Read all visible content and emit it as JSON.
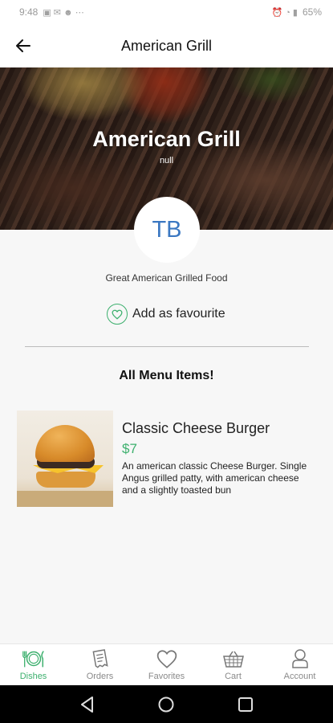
{
  "status_bar": {
    "time": "9:48",
    "left_glyphs": "▣ ✉ ☻ ⋯",
    "right_glyphs": "⏰ ◔ ▮",
    "battery": "65%"
  },
  "app_bar": {
    "title": "American Grill"
  },
  "hero": {
    "title": "American Grill",
    "subtitle": "null"
  },
  "avatar": {
    "initials": "TB"
  },
  "restaurant": {
    "description": "Great American Grilled Food"
  },
  "favourite": {
    "label": "Add as favourite"
  },
  "menu": {
    "heading": "All Menu Items!",
    "items": [
      {
        "name": "Classic Cheese Burger",
        "price": "$7",
        "description": "An american classic Cheese Burger. Single Angus grilled patty, with american cheese and a slightly toasted bun"
      }
    ]
  },
  "bottom_nav": {
    "items": [
      {
        "label": "Dishes",
        "icon": "plate-cutlery-icon",
        "active": true
      },
      {
        "label": "Orders",
        "icon": "receipt-icon",
        "active": false
      },
      {
        "label": "Favorites",
        "icon": "heart-icon",
        "active": false
      },
      {
        "label": "Cart",
        "icon": "basket-icon",
        "active": false
      },
      {
        "label": "Account",
        "icon": "person-icon",
        "active": false
      }
    ]
  },
  "colors": {
    "accent": "#3db06e",
    "avatar_text": "#3b78c2"
  }
}
